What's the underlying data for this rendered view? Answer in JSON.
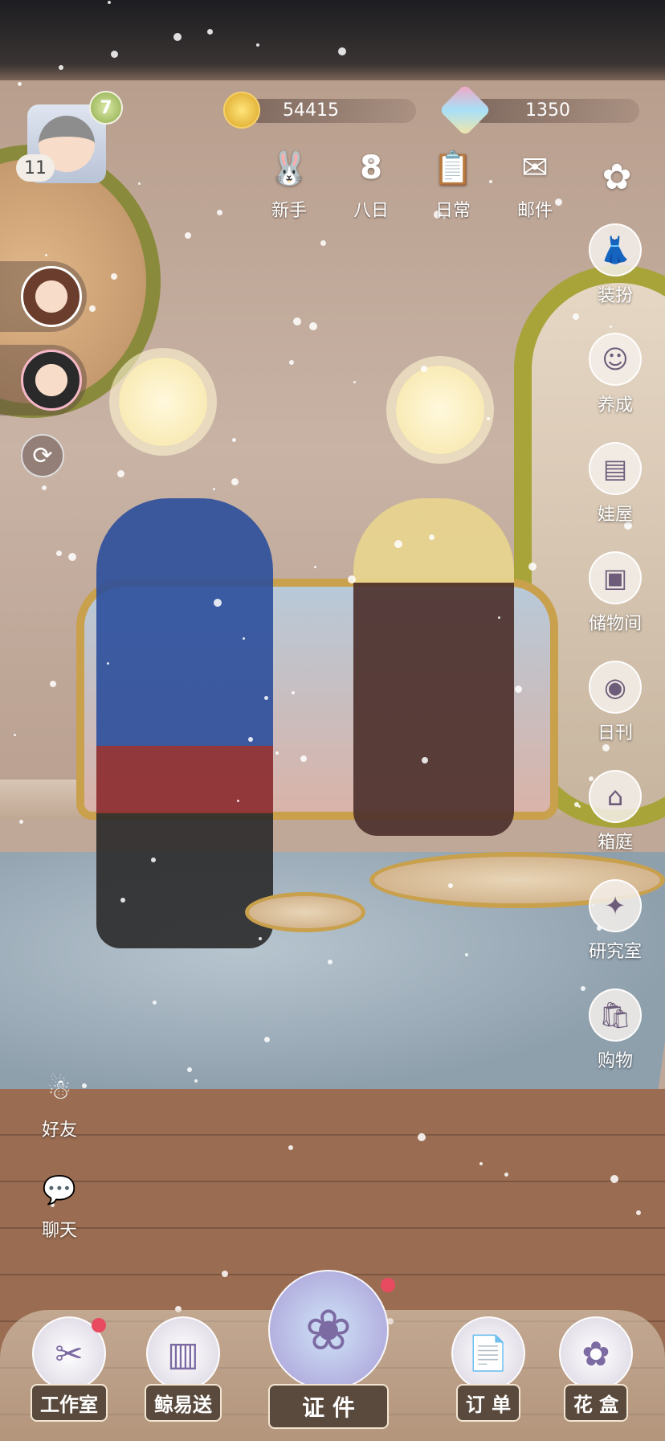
{
  "player": {
    "level": "7",
    "badge_count": "11"
  },
  "currency": {
    "coins": "54415",
    "gems": "1350"
  },
  "top_menu": [
    {
      "label": "新手",
      "icon": "bunny-cake-icon"
    },
    {
      "label": "八日",
      "icon": "eight-day-icon"
    },
    {
      "label": "日常",
      "icon": "clipboard-icon"
    },
    {
      "label": "邮件",
      "icon": "mail-icon"
    }
  ],
  "right_menu": [
    {
      "label": "装扮",
      "icon": "hanger-icon"
    },
    {
      "label": "养成",
      "icon": "doll-icon"
    },
    {
      "label": "娃屋",
      "icon": "cabinet-icon"
    },
    {
      "label": "储物间",
      "icon": "storage-box-icon"
    },
    {
      "label": "日刊",
      "icon": "camera-icon"
    },
    {
      "label": "箱庭",
      "icon": "diorama-icon"
    },
    {
      "label": "研究室",
      "icon": "research-book-icon"
    },
    {
      "label": "购物",
      "icon": "shopping-bag-icon"
    }
  ],
  "social": {
    "friends_label": "好友",
    "chat_label": "聊天"
  },
  "bottom": {
    "workshop": "工作室",
    "delivery": "鲸易送",
    "certificate": "证 件",
    "orders": "订 单",
    "flower_box": "花 盒"
  }
}
